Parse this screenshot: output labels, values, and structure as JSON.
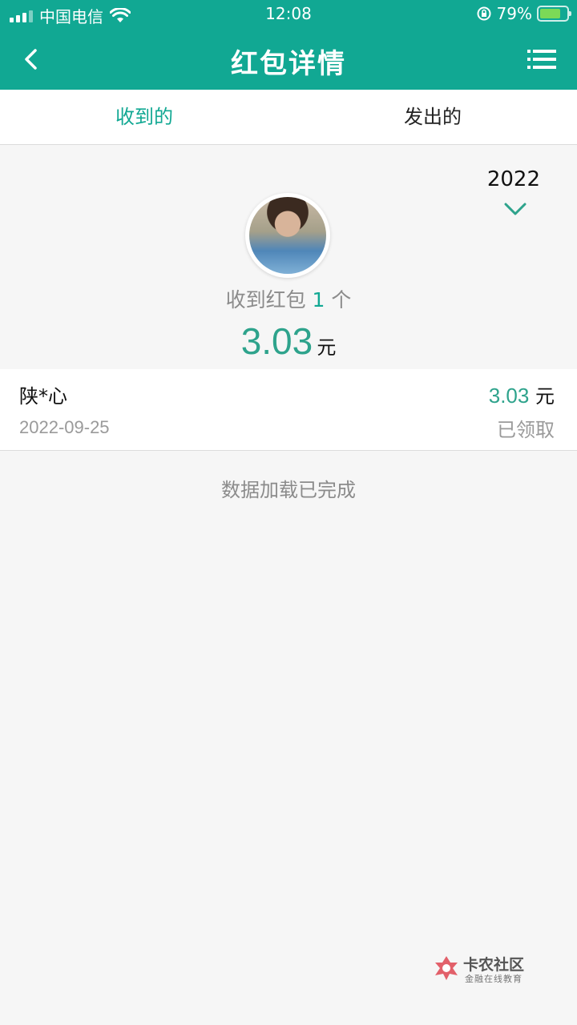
{
  "status_bar": {
    "carrier": "中国电信",
    "time": "12:08",
    "battery": "79%",
    "battery_level": 0.79
  },
  "nav": {
    "title": "红包详情",
    "back_icon": "chevron-left-icon",
    "menu_icon": "list-menu-icon"
  },
  "tabs": [
    {
      "label": "收到的",
      "active": true
    },
    {
      "label": "发出的",
      "active": false
    }
  ],
  "summary": {
    "year": "2022",
    "received_prefix": "收到红包",
    "received_count": "1",
    "received_suffix": "个",
    "total_amount": "3.03",
    "unit": "元"
  },
  "records": [
    {
      "name": "陕*心",
      "date": "2022-09-25",
      "amount": "3.03",
      "unit": "元",
      "status": "已领取"
    }
  ],
  "footer_text": "数据加载已完成",
  "watermark": {
    "title": "卡农社区",
    "subtitle": "金融在线教育"
  },
  "colors": {
    "primary": "#11a893",
    "amount": "#2ea38c"
  }
}
